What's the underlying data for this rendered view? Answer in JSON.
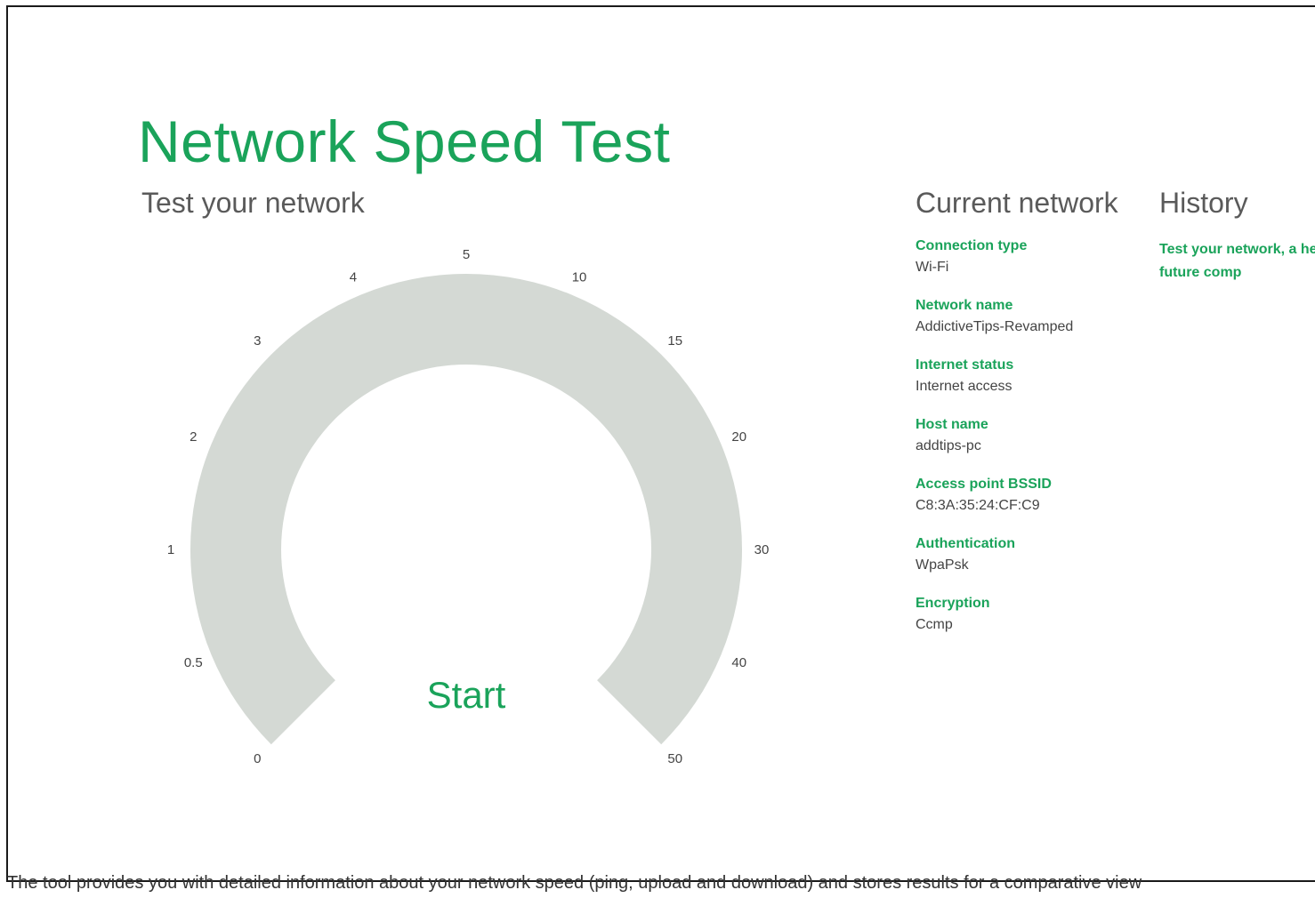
{
  "app": {
    "title": "Network Speed Test",
    "subtitle": "Test your network"
  },
  "gauge": {
    "ticks": [
      "0",
      "0.5",
      "1",
      "2",
      "3",
      "4",
      "5",
      "10",
      "15",
      "20",
      "30",
      "40",
      "50"
    ],
    "start_label": "Start",
    "track_color": "#d4d9d4",
    "accent_color": "#1aa35a"
  },
  "current_network": {
    "heading": "Current network",
    "items": [
      {
        "label": "Connection type",
        "value": "Wi-Fi"
      },
      {
        "label": "Network name",
        "value": "AddictiveTips-Revamped"
      },
      {
        "label": "Internet status",
        "value": "Internet access"
      },
      {
        "label": "Host name",
        "value": "addtips-pc"
      },
      {
        "label": "Access point BSSID",
        "value": "C8:3A:35:24:CF:C9"
      },
      {
        "label": "Authentication",
        "value": "WpaPsk"
      },
      {
        "label": "Encryption",
        "value": "Ccmp"
      }
    ]
  },
  "history": {
    "heading": "History",
    "message": "Test your network, a here for future comp"
  },
  "caption": "The tool provides you with detailed information about your network speed (ping, upload and download) and stores results for a comparative view"
}
